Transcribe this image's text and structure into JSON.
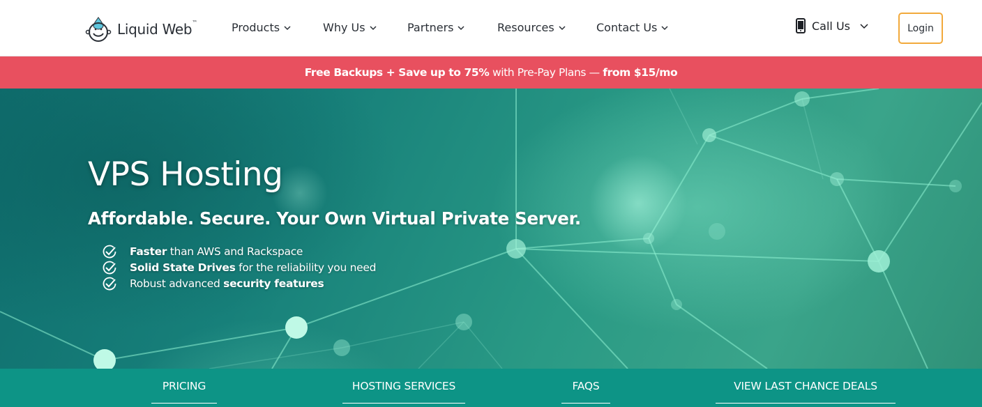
{
  "brand": {
    "name": "Liquid Web",
    "trademark": "™",
    "logo_icon": "liquid-web-logo-icon"
  },
  "nav": {
    "items": [
      {
        "label": "Products"
      },
      {
        "label": "Why Us"
      },
      {
        "label": "Partners"
      },
      {
        "label": "Resources"
      },
      {
        "label": "Contact Us"
      }
    ],
    "call_label": "Call Us",
    "login_label": "Login"
  },
  "promo": {
    "part1": "Free Backups + Save up to 75%",
    "part2": " with Pre-Pay Plans — ",
    "part3": "from $15/mo"
  },
  "hero": {
    "title": "VPS Hosting",
    "subtitle": "Affordable. Secure. Your Own Virtual Private Server.",
    "features": [
      {
        "bold": "Faster",
        "rest": " than AWS and Rackspace"
      },
      {
        "bold": "Solid State Drives",
        "rest": " for the reliability you need"
      },
      {
        "pre": "Robust advanced ",
        "bold": "security features"
      }
    ]
  },
  "tabs": [
    {
      "label": "PRICING"
    },
    {
      "label": "HOSTING SERVICES"
    },
    {
      "label": "FAQS"
    },
    {
      "label": "VIEW LAST CHANCE DEALS"
    }
  ],
  "colors": {
    "promo_bg": "#e8505f",
    "login_border": "#f2a93b",
    "tabbar_bg": "#0d9486",
    "hero_base": "#17807a"
  }
}
